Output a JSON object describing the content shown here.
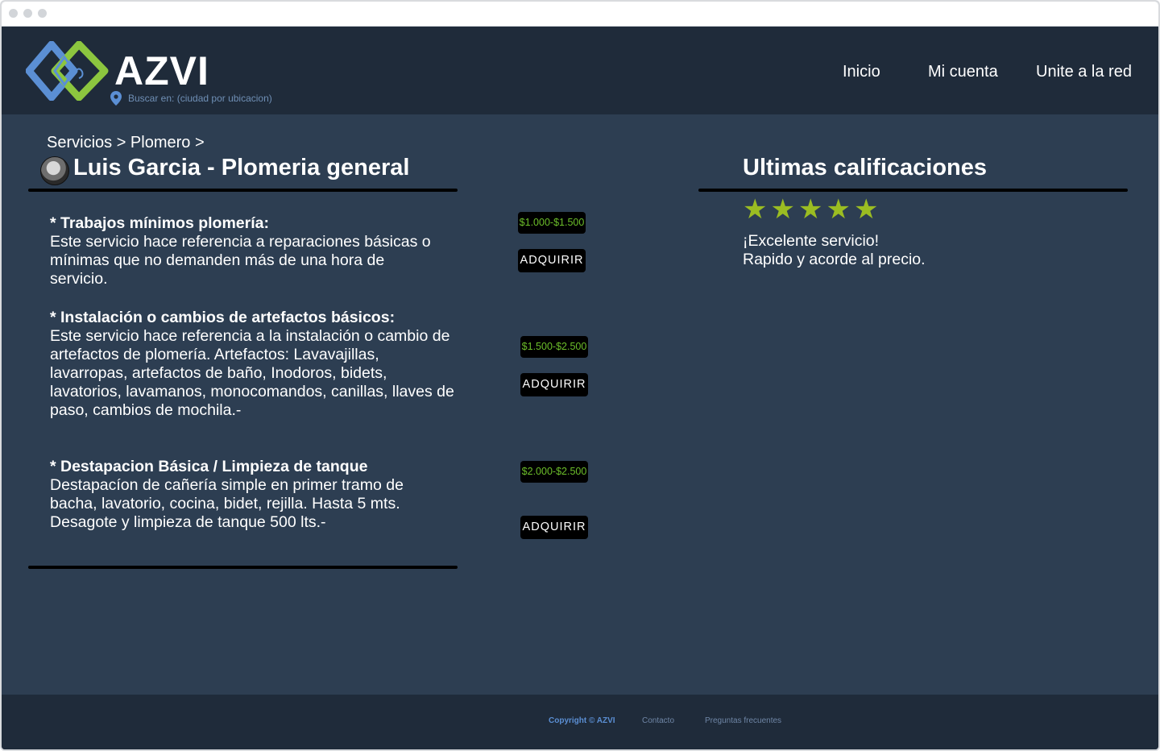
{
  "header": {
    "brand": "AZVI",
    "location_hint": "Buscar en: (ciudad por ubicacion)",
    "nav": [
      "Inicio",
      "Mi cuenta",
      "Unite a la red"
    ]
  },
  "breadcrumb": "Servicios > Plomero >",
  "provider": {
    "heading": "Luis Garcia - Plomeria general"
  },
  "services": [
    {
      "title": "* Trabajos mínimos plomería:",
      "description": "Este servicio hace referencia a reparaciones básicas o mínimas que no demanden más de una hora de servicio.",
      "price": "$1.000-$1.500",
      "button": "ADQUIRIR"
    },
    {
      "title": "* Instalación o cambios de artefactos básicos:",
      "description": "Este servicio hace referencia a la instalación o cambio de artefactos de plomería. Artefactos: Lavavajillas, lavarropas, artefactos de baño, Inodoros, bidets, lavatorios, lavamanos, monocomandos, canillas, llaves de paso, cambios de mochila.-",
      "price": "$1.500-$2.500",
      "button": "ADQUIRIR"
    },
    {
      "title": "* Destapacion Básica / Limpieza de tanque",
      "description_lines": [
        "Destapacíon de cañería simple en primer tramo de bacha, lavatorio, cocina, bidet, rejilla. Hasta 5 mts.",
        "Desagote y limpieza de tanque 500 lts.-"
      ],
      "price": "$2.000-$2.500",
      "button": "ADQUIRIR"
    }
  ],
  "ratings": {
    "heading": "Ultimas calificaciones",
    "stars": 5,
    "star_color": "#9bbd22",
    "review_lines": [
      "¡Excelente servicio!",
      "Rapido y acorde al precio."
    ]
  },
  "footer": {
    "copyright": "Copyright © AZVI",
    "contact": "Contacto",
    "faq": "Preguntas frecuentes"
  },
  "colors": {
    "page_bg": "#2d3e52",
    "bar_bg": "#1f2b3a",
    "price_text": "#6cbf2a",
    "accent_blue": "#5b8fd4",
    "accent_green": "#8cc63f"
  }
}
